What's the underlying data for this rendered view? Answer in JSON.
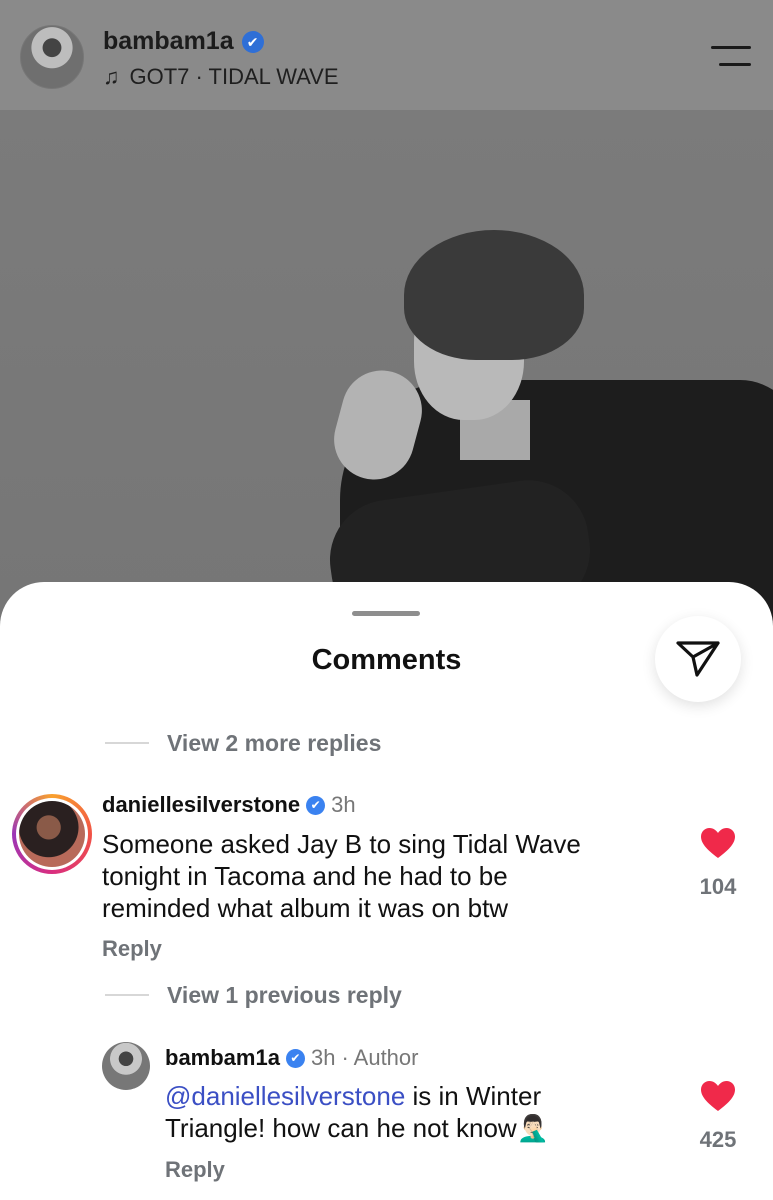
{
  "header": {
    "username": "bambam1a",
    "verified_mark": "✔",
    "music_note": "♫",
    "music": "GOT7 · TIDAL WAVE"
  },
  "sheet": {
    "title": "Comments",
    "send_icon": "send-paper-plane-icon"
  },
  "thread": {
    "view_more_replies": "View 2 more replies",
    "comment": {
      "username": "daniellesilverstone",
      "time": "3h",
      "text_lines": [
        "Someone asked Jay B to sing Tidal Wave",
        "tonight in Tacoma and he had to be",
        "reminded what album it was on btw"
      ],
      "reply_label": "Reply",
      "likes": "104"
    },
    "view_previous_reply": "View 1 previous reply",
    "reply": {
      "username": "bambam1a",
      "time": "3h",
      "author_tag": "· Author",
      "mention": "@daniellesilverstone",
      "text_rest": " is in Winter",
      "text_line2": "Triangle! how can he not know",
      "emoji": "🤦🏻‍♂️",
      "reply_label": "Reply",
      "likes": "425"
    }
  },
  "colors": {
    "heart": "#f0294a",
    "verified": "#3a82f0",
    "mention": "#3b4fc4"
  }
}
